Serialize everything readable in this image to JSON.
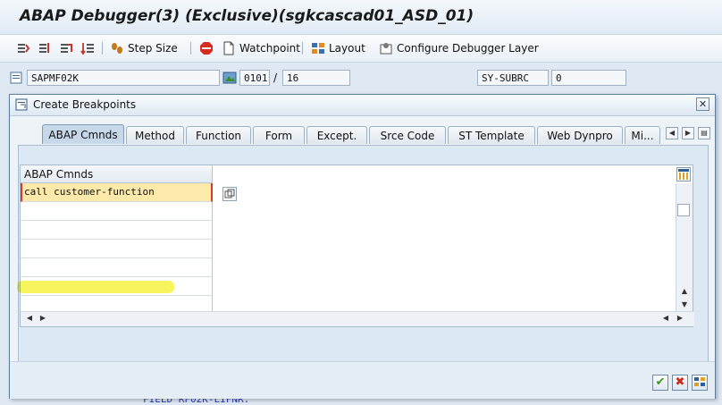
{
  "window": {
    "title": "ABAP Debugger(3)  (Exclusive)(sgkcascad01_ASD_01)"
  },
  "toolbar": {
    "step_size": "Step Size",
    "watchpoint": "Watchpoint",
    "layout": "Layout",
    "configure": "Configure Debugger Layer"
  },
  "fields": {
    "program": "SAPMF02K",
    "screen": "0101",
    "separator": "/",
    "line": "16",
    "sysubrc_label": "SY-SUBRC",
    "sysubrc_value": "0"
  },
  "background_code": "FIELD RF02K-LIFNR.",
  "dialog": {
    "title": "Create Breakpoints",
    "close": "✕",
    "tabs": [
      "ABAP Cmnds",
      "Method",
      "Function",
      "Form",
      "Except.",
      "Srce Code",
      "ST Template",
      "Web Dynpro",
      "Mi..."
    ],
    "grid": {
      "header": "ABAP Cmnds",
      "rows": [
        "call customer-function",
        "",
        "",
        "",
        "",
        "",
        ""
      ]
    }
  },
  "colors": {
    "accent": "#c6d8ea",
    "highlight": "#f5f028",
    "row_fill": "#fde9a9",
    "ok_green": "#3c9a1f",
    "cancel_red": "#cc2a1a"
  }
}
